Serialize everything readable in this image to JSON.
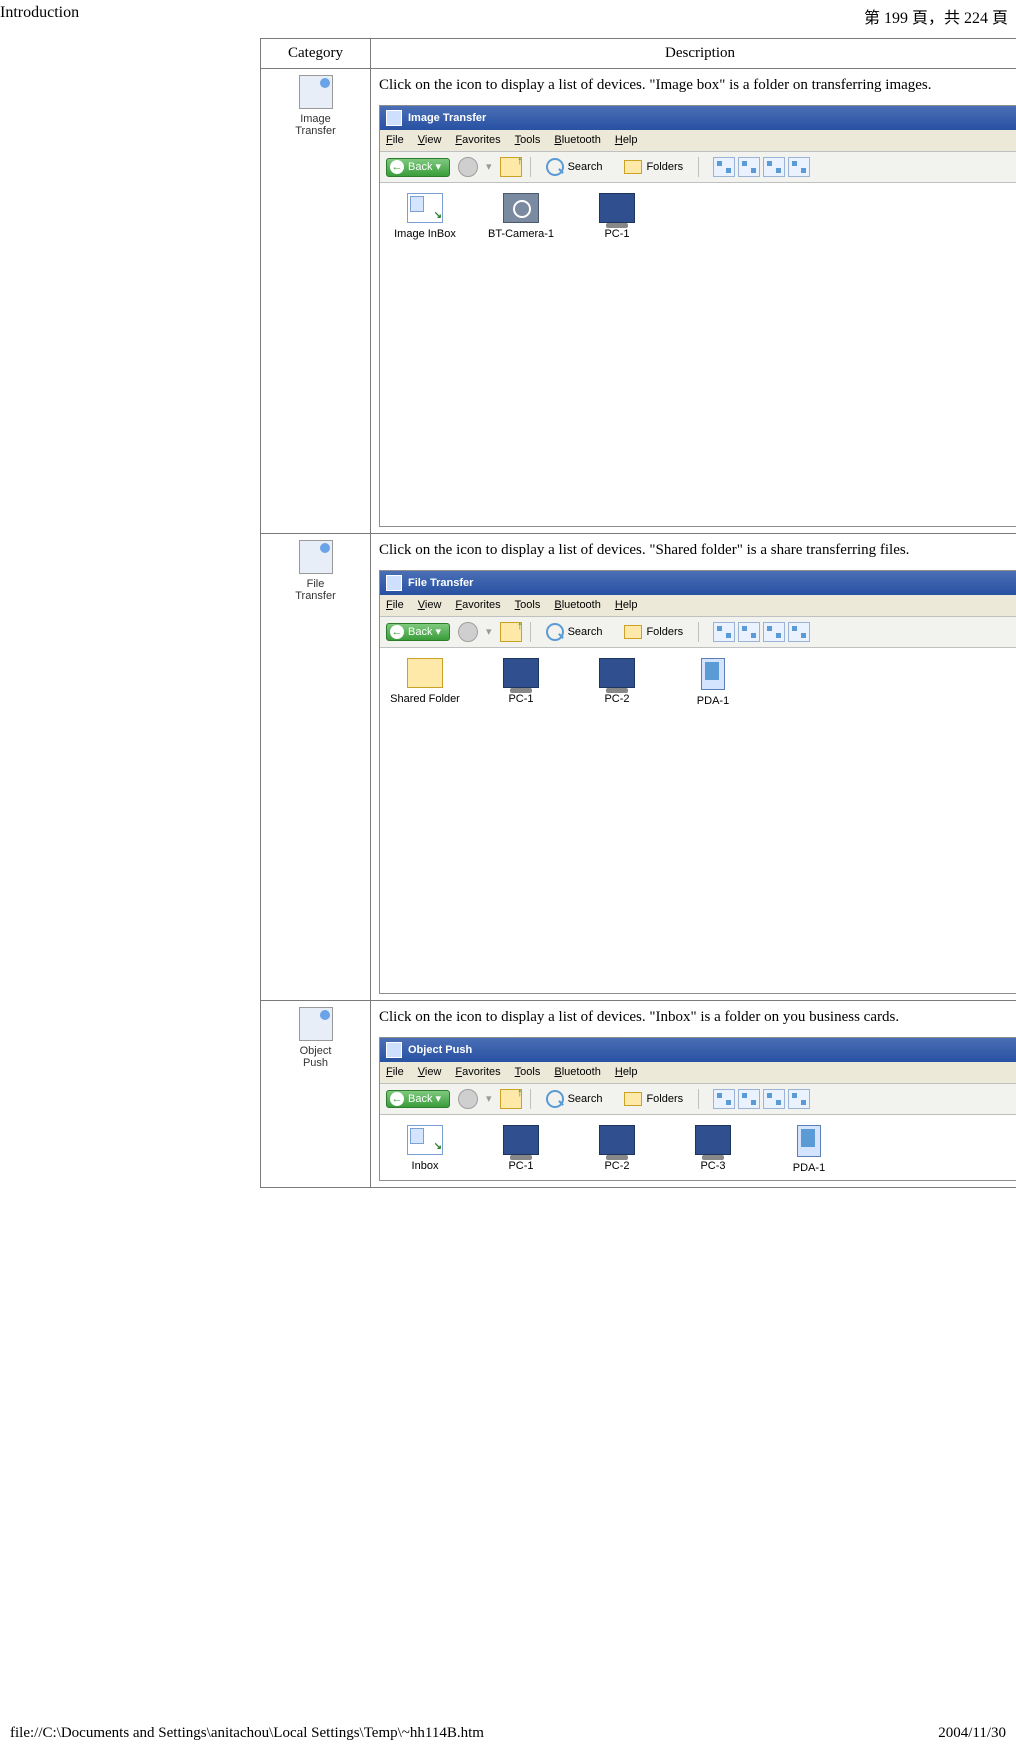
{
  "header": {
    "title": "Introduction",
    "page_current": "199",
    "page_total": "224",
    "page_prefix": "第",
    "page_mid": "頁，共",
    "page_suffix": "頁"
  },
  "table": {
    "col_category": "Category",
    "col_description": "Description"
  },
  "rows": [
    {
      "cat_label": "Image Transfer",
      "desc": "Click on the icon to display a list of devices. \"Image box\" is a folder on transferring images.",
      "window_title": "Image Transfer",
      "menus": [
        "File",
        "View",
        "Favorites",
        "Tools",
        "Bluetooth",
        "Help"
      ],
      "toolbar": {
        "back": "Back",
        "search": "Search",
        "folders": "Folders"
      },
      "files": [
        {
          "label": "Image InBox",
          "type": "box"
        },
        {
          "label": "BT-Camera-1",
          "type": "cam"
        },
        {
          "label": "PC-1",
          "type": "pc"
        }
      ],
      "tall": true
    },
    {
      "cat_label": "File Transfer",
      "desc": "Click on the icon to display a list of devices. \"Shared folder\" is a share transferring files.",
      "window_title": "File Transfer",
      "menus": [
        "File",
        "View",
        "Favorites",
        "Tools",
        "Bluetooth",
        "Help"
      ],
      "toolbar": {
        "back": "Back",
        "search": "Search",
        "folders": "Folders"
      },
      "files": [
        {
          "label": "Shared Folder",
          "type": "folder"
        },
        {
          "label": "PC-1",
          "type": "pc"
        },
        {
          "label": "PC-2",
          "type": "pc"
        },
        {
          "label": "PDA-1",
          "type": "pda"
        }
      ],
      "tall": true
    },
    {
      "cat_label": "Object Push",
      "desc": "Click on the icon to display a list of devices. \"Inbox\" is a folder on you business cards.",
      "window_title": "Object Push",
      "menus": [
        "File",
        "View",
        "Favorites",
        "Tools",
        "Bluetooth",
        "Help"
      ],
      "toolbar": {
        "back": "Back",
        "search": "Search",
        "folders": "Folders"
      },
      "files": [
        {
          "label": "Inbox",
          "type": "box"
        },
        {
          "label": "PC-1",
          "type": "pc"
        },
        {
          "label": "PC-2",
          "type": "pc"
        },
        {
          "label": "PC-3",
          "type": "pc"
        },
        {
          "label": "PDA-1",
          "type": "pda"
        }
      ],
      "tall": false
    }
  ],
  "footer": {
    "path": "file://C:\\Documents and Settings\\anitachou\\Local Settings\\Temp\\~hh114B.htm",
    "date": "2004/11/30"
  }
}
